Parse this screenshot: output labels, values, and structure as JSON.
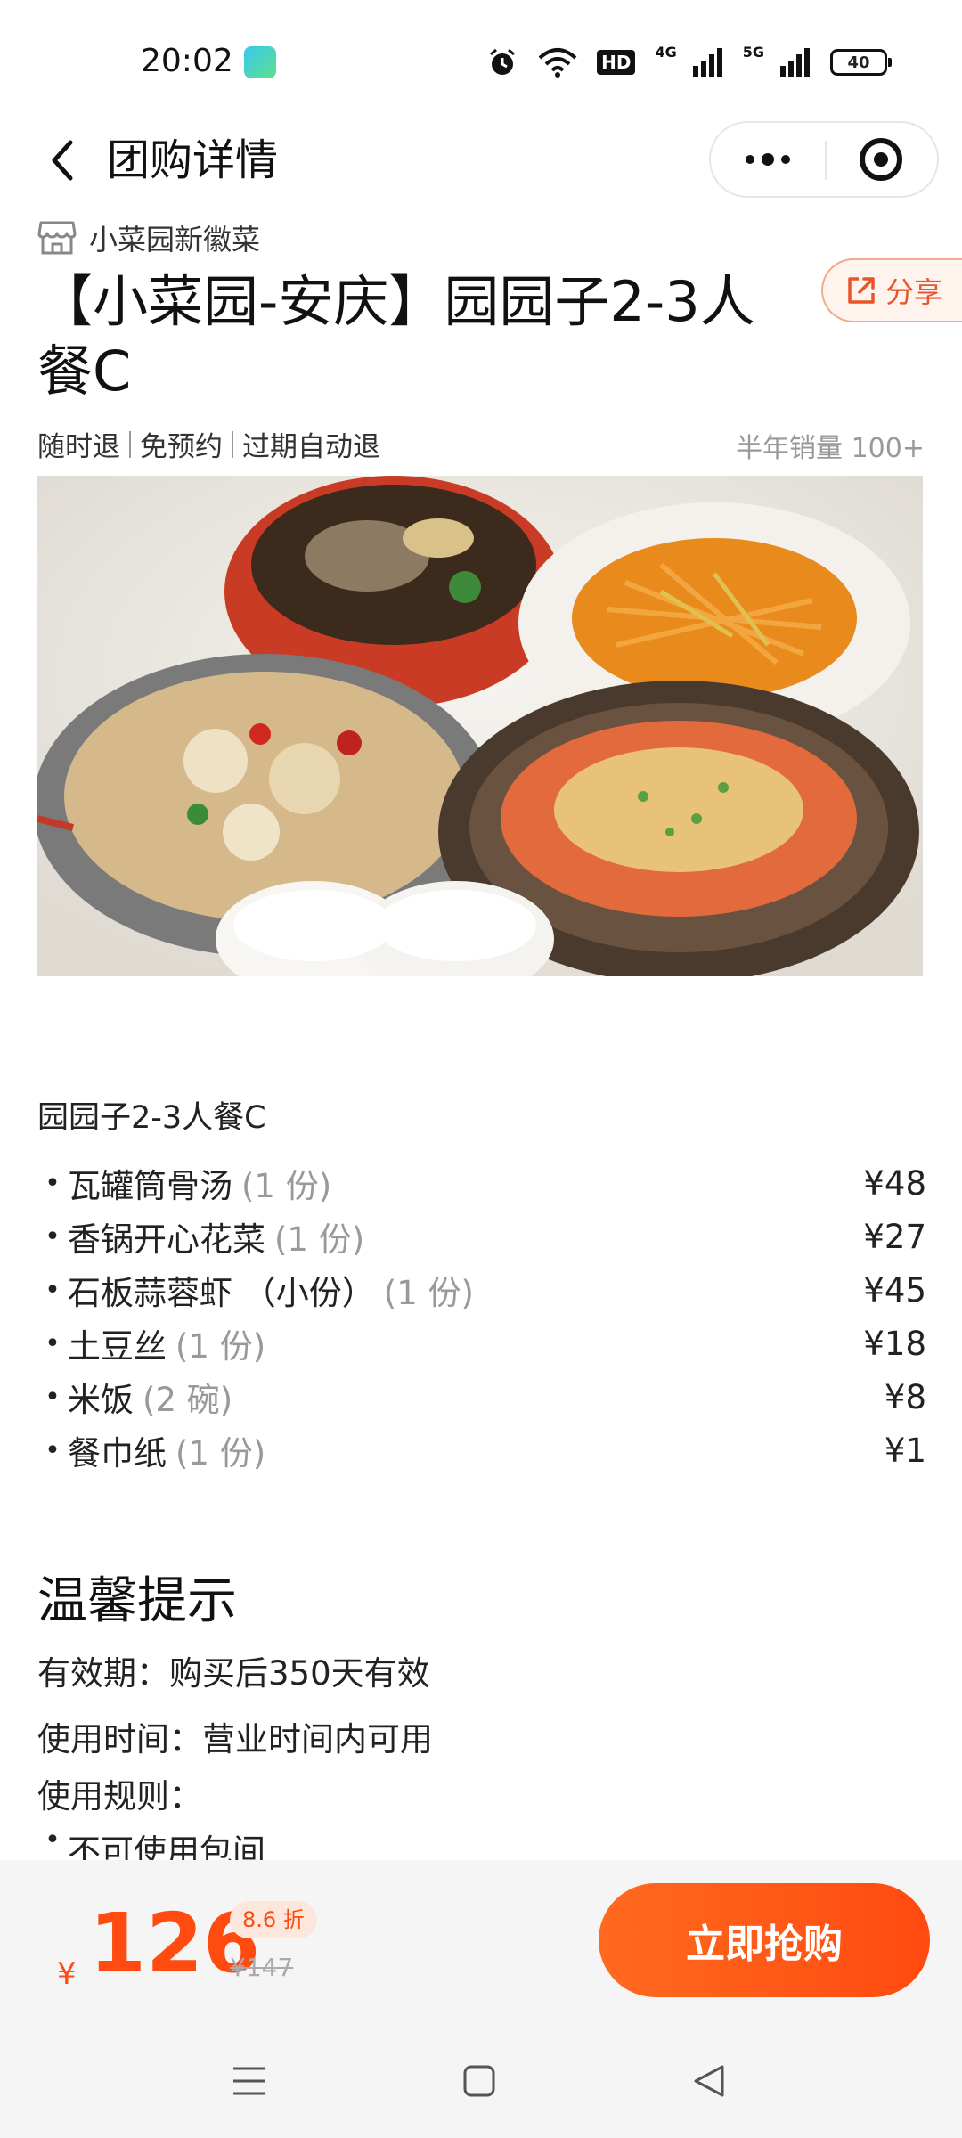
{
  "status_bar": {
    "time": "20:02",
    "network_a": "4G",
    "network_b": "5G",
    "hd": "HD",
    "battery": "40"
  },
  "nav": {
    "title": "团购详情"
  },
  "shop": {
    "name": "小菜园新徽菜"
  },
  "share": {
    "label": "分享"
  },
  "deal": {
    "title": "【小菜园-安庆】园园子2-3人餐C",
    "tags": [
      "随时退",
      "免预约",
      "过期自动退"
    ],
    "sales": "半年销量 100+"
  },
  "menu": {
    "title": "园园子2-3人餐C",
    "items": [
      {
        "name": "瓦罐筒骨汤",
        "qty": "(1 份)",
        "price": "¥48"
      },
      {
        "name": "香锅开心花菜",
        "qty": "(1 份)",
        "price": "¥27"
      },
      {
        "name": "石板蒜蓉虾 （小份）",
        "qty": "(1 份)",
        "price": "¥45"
      },
      {
        "name": "土豆丝",
        "qty": "(1 份)",
        "price": "¥18"
      },
      {
        "name": "米饭",
        "qty": "(2 碗)",
        "price": "¥8"
      },
      {
        "name": "餐巾纸",
        "qty": "(1 份)",
        "price": "¥1"
      }
    ]
  },
  "tips": {
    "title": "温馨提示",
    "validity": "有效期：购买后350天有效",
    "usage_time": "使用时间：营业时间内可用",
    "rules_label": "使用规则：",
    "rule_1": "不可使用包间"
  },
  "purchase": {
    "currency": "¥",
    "price": "126",
    "discount": "8.6 折",
    "original_price": "¥147",
    "button": "立即抢购"
  },
  "colors": {
    "accent": "#ff4a10",
    "share_border": "#f3a98a"
  }
}
